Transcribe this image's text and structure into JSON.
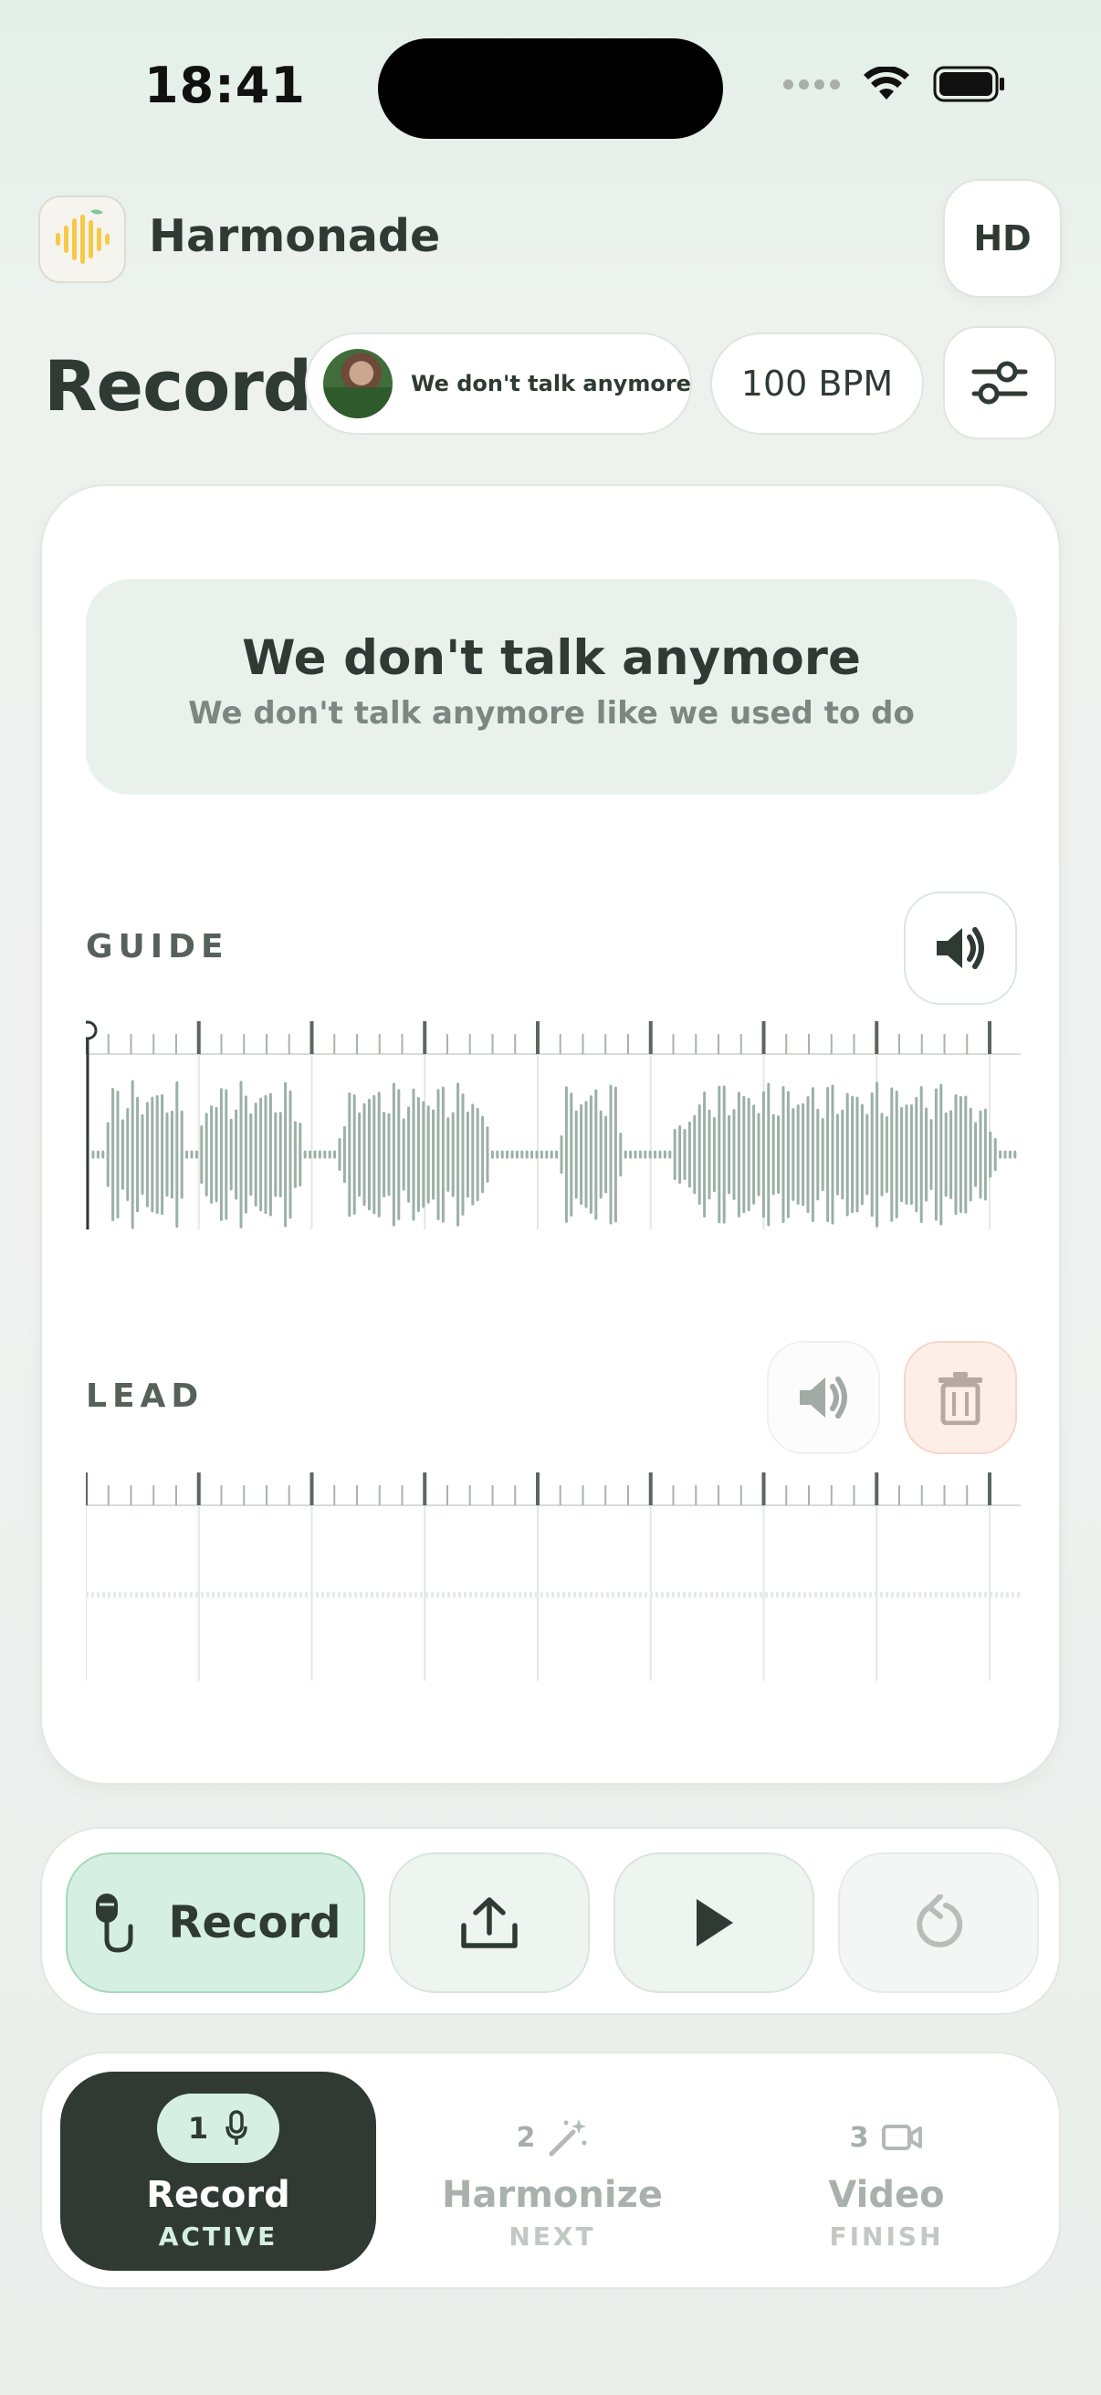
{
  "status_bar": {
    "time": "18:41"
  },
  "header": {
    "app_name": "Harmonade",
    "hd_label": "HD"
  },
  "toolbar": {
    "page_title": "Record",
    "song_label": "We don't talk anymore",
    "bpm_label": "100 BPM"
  },
  "lyrics": {
    "title": "We don't talk anymore",
    "line": "We don't talk anymore like we used to do"
  },
  "tracks": {
    "guide": {
      "label": "GUIDE",
      "playhead": 0.0
    },
    "lead": {
      "label": "LEAD",
      "recorded": false
    }
  },
  "controls": {
    "record_label": "Record"
  },
  "steps": [
    {
      "number": "1",
      "title": "Record",
      "status": "ACTIVE"
    },
    {
      "number": "2",
      "title": "Harmonize",
      "status": "NEXT"
    },
    {
      "number": "3",
      "title": "Video",
      "status": "FINISH"
    }
  ],
  "colors": {
    "accent": "#d5f0e2",
    "dark": "#303a33",
    "waveform": "#9bb0a6",
    "danger_bg": "#fdeee7"
  }
}
